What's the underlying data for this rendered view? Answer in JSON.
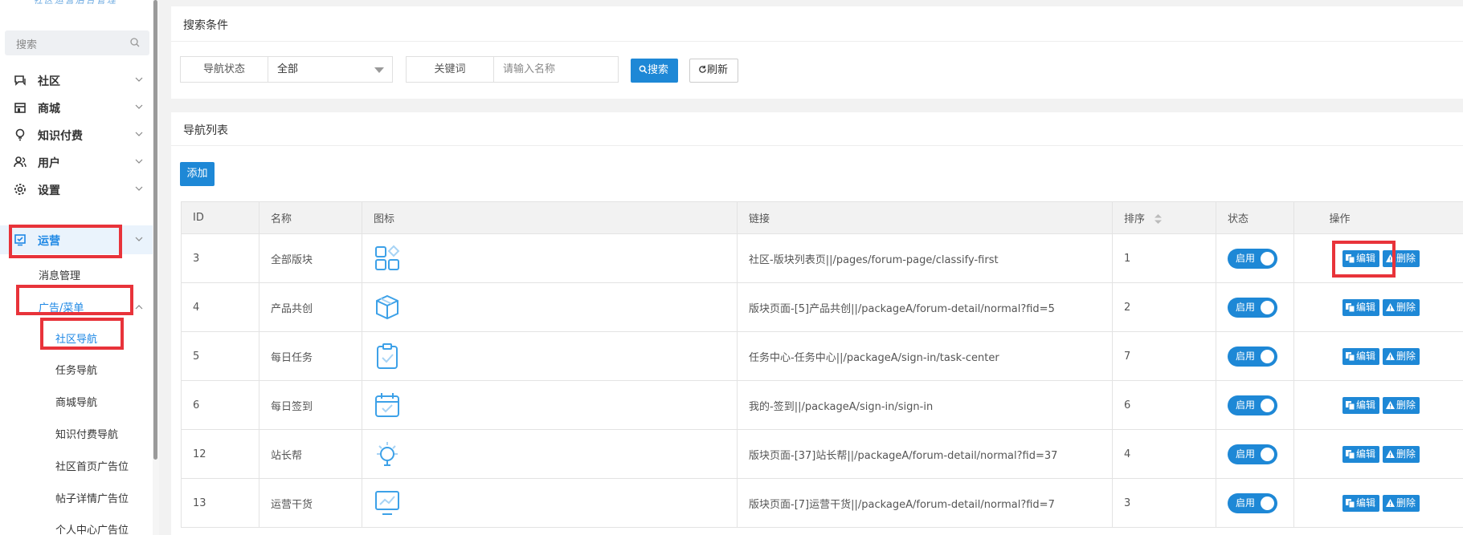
{
  "sidebar": {
    "logo": "社区运营后台管理",
    "search_placeholder": "搜索",
    "menu": [
      {
        "label": "社区",
        "icon": "chat-icon"
      },
      {
        "label": "商城",
        "icon": "store-icon"
      },
      {
        "label": "知识付费",
        "icon": "lightbulb-icon"
      },
      {
        "label": "用户",
        "icon": "users-icon"
      },
      {
        "label": "设置",
        "icon": "gear-icon"
      },
      {
        "label": "运营",
        "icon": "operations-icon"
      }
    ],
    "sub_menu": [
      {
        "label": "消息管理"
      },
      {
        "label": "广告/菜单"
      }
    ],
    "sub2_menu": [
      {
        "label": "社区导航"
      },
      {
        "label": "任务导航"
      },
      {
        "label": "商城导航"
      },
      {
        "label": "知识付费导航"
      },
      {
        "label": "社区首页广告位"
      },
      {
        "label": "帖子详情广告位"
      },
      {
        "label": "个人中心广告位"
      }
    ]
  },
  "search_panel": {
    "title": "搜索条件",
    "status_label": "导航状态",
    "status_value": "全部",
    "keyword_label": "关键词",
    "keyword_placeholder": "请输入名称",
    "search_button": "搜索",
    "refresh_button": "刷新"
  },
  "list_panel": {
    "title": "导航列表",
    "add_button": "添加",
    "columns": [
      "ID",
      "名称",
      "图标",
      "链接",
      "排序",
      "状态",
      "操作"
    ],
    "rows": [
      {
        "id": "3",
        "name": "全部版块",
        "icon": "grid-apps-icon",
        "link": "社区-版块列表页||/pages/forum-page/classify-first",
        "sort": "1",
        "status": "启用"
      },
      {
        "id": "4",
        "name": "产品共创",
        "icon": "cube-icon",
        "link": "版块页面-[5]产品共创||/packageA/forum-detail/normal?fid=5",
        "sort": "2",
        "status": "启用"
      },
      {
        "id": "5",
        "name": "每日任务",
        "icon": "clipboard-check-icon",
        "link": "任务中心-任务中心||/packageA/sign-in/task-center",
        "sort": "7",
        "status": "启用"
      },
      {
        "id": "6",
        "name": "每日签到",
        "icon": "calendar-check-icon",
        "link": "我的-签到||/packageA/sign-in/sign-in",
        "sort": "6",
        "status": "启用"
      },
      {
        "id": "12",
        "name": "站长帮",
        "icon": "lightbulb-icon",
        "link": "版块页面-[37]站长帮||/packageA/forum-detail/normal?fid=37",
        "sort": "4",
        "status": "启用"
      },
      {
        "id": "13",
        "name": "运营干货",
        "icon": "chart-monitor-icon",
        "link": "版块页面-[7]运营干货||/packageA/forum-detail/normal?fid=7",
        "sort": "3",
        "status": "启用"
      }
    ],
    "edit_label": "编辑",
    "delete_label": "删除"
  },
  "colors": {
    "accent": "#1e88d6",
    "highlight_box": "#e8333a"
  }
}
